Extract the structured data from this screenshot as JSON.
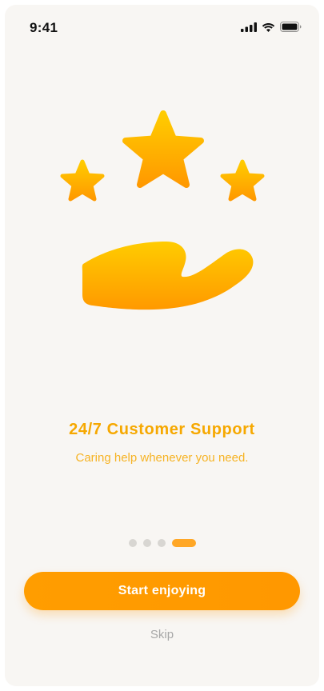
{
  "status_bar": {
    "time": "9:41",
    "icons": [
      "cellular-signal-icon",
      "wifi-icon",
      "battery-icon"
    ]
  },
  "illustration": {
    "icons": [
      "star-left-icon",
      "star-center-icon",
      "star-right-icon",
      "hand-icon"
    ],
    "colors": {
      "gradient_top": "#ffcc00",
      "gradient_bottom": "#ff9900"
    }
  },
  "onboarding": {
    "title": "24/7 Customer Support",
    "subtitle": "Caring help whenever you need.",
    "pager": {
      "total": 4,
      "active_index": 3
    }
  },
  "actions": {
    "primary_label": "Start enjoying",
    "skip_label": "Skip"
  },
  "colors": {
    "accent": "#f6a800",
    "button": "#ff9d00",
    "background": "#f8f6f3"
  }
}
